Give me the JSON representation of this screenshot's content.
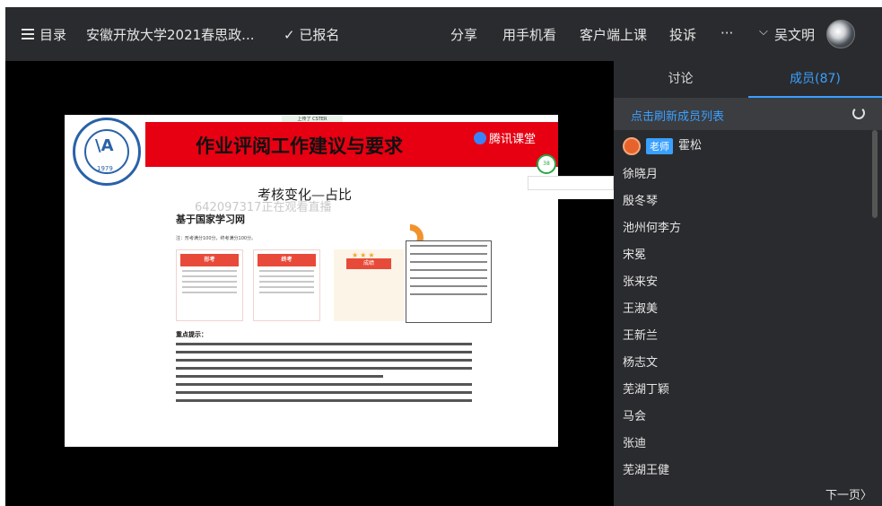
{
  "header": {
    "catalog_label": "目录",
    "course_title": "安徽开放大学2021春思政...",
    "enrolled_label": "✓ 已报名",
    "share_label": "分享",
    "mobile_label": "用手机看",
    "client_label": "客户端上课",
    "complain_label": "投诉",
    "more_label": "···",
    "user_name": "吴文明",
    "user_chevron": "⌵"
  },
  "slide": {
    "title": "作业评阅工作建议与要求",
    "top_tag": "上传了 CSTER",
    "logo_text": "1979",
    "logo_mark": "\\A",
    "tencent_label": "腾讯课堂",
    "badge_text": "38",
    "subtitle": "考核变化—占比",
    "watermark": "642097317正在观看直播",
    "section_label": "基于国家学习网",
    "tiny_note": "注：形考满分100分，终考满分100分。",
    "card1_label": "形考",
    "card2_label": "终考",
    "card3_label": "成绩",
    "rules_heading": "重点提示："
  },
  "panel": {
    "tabs": [
      {
        "label": "讨论",
        "active": false
      },
      {
        "label": "成员(87)",
        "active": true
      }
    ],
    "refresh_label": "点击刷新成员列表",
    "teacher_role": "老师",
    "members": [
      "霍松",
      "徐晓月",
      "殷冬琴",
      "池州何李方",
      "宋冕",
      "张来安",
      "王淑美",
      "王新兰",
      "杨志文",
      "芜湖丁颖",
      "马会",
      "张迪",
      "芜湖王健"
    ],
    "next_page_label": "下一页〉"
  },
  "colors": {
    "accent": "#3aa0ff",
    "slide_red": "#e60012",
    "topbar_bg": "#2a2b2e"
  }
}
